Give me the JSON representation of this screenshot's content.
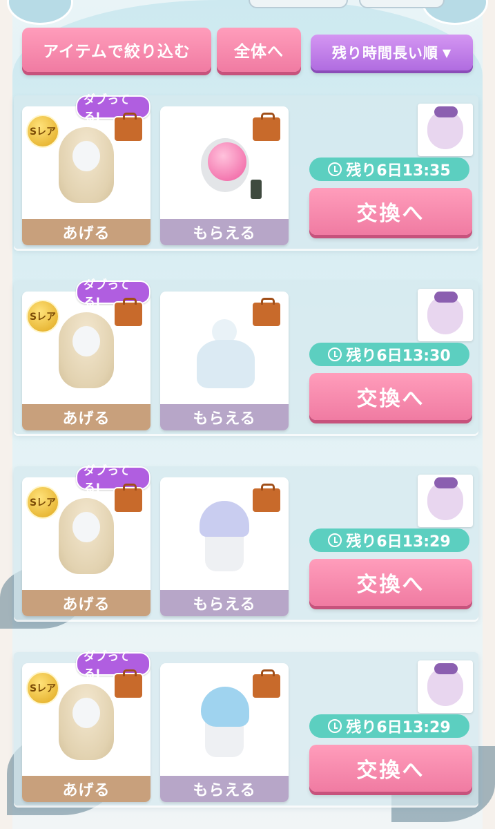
{
  "toolbar": {
    "filter_label": "アイテムで絞り込む",
    "all_label": "全体へ",
    "sort_label": "残り時間長い順"
  },
  "colors": {
    "accent_pink": "#f07ba2",
    "accent_purple": "#b06ce0",
    "timer_teal": "#5ccfc0"
  },
  "listings": [
    {
      "dup_badge": "ダブってる!",
      "rarity": "Sレア",
      "give_label": "あげる",
      "get_label": "もらえる",
      "timer": "残り6日13:35",
      "exchange_label": "交換へ",
      "get_item_icon": "chair-icon"
    },
    {
      "dup_badge": "ダブってる!",
      "rarity": "Sレア",
      "give_label": "あげる",
      "get_label": "もらえる",
      "timer": "残り6日13:30",
      "exchange_label": "交換へ",
      "get_item_icon": "dress-icon"
    },
    {
      "dup_badge": "ダブってる!",
      "rarity": "Sレア",
      "give_label": "あげる",
      "get_label": "もらえる",
      "timer": "残り6日13:29",
      "exchange_label": "交換へ",
      "get_item_icon": "knit-hat-icon"
    },
    {
      "dup_badge": "ダブってる!",
      "rarity": "Sレア",
      "give_label": "あげる",
      "get_label": "もらえる",
      "timer": "残り6日13:29",
      "exchange_label": "交換へ",
      "get_item_icon": "blue-hair-icon"
    }
  ]
}
